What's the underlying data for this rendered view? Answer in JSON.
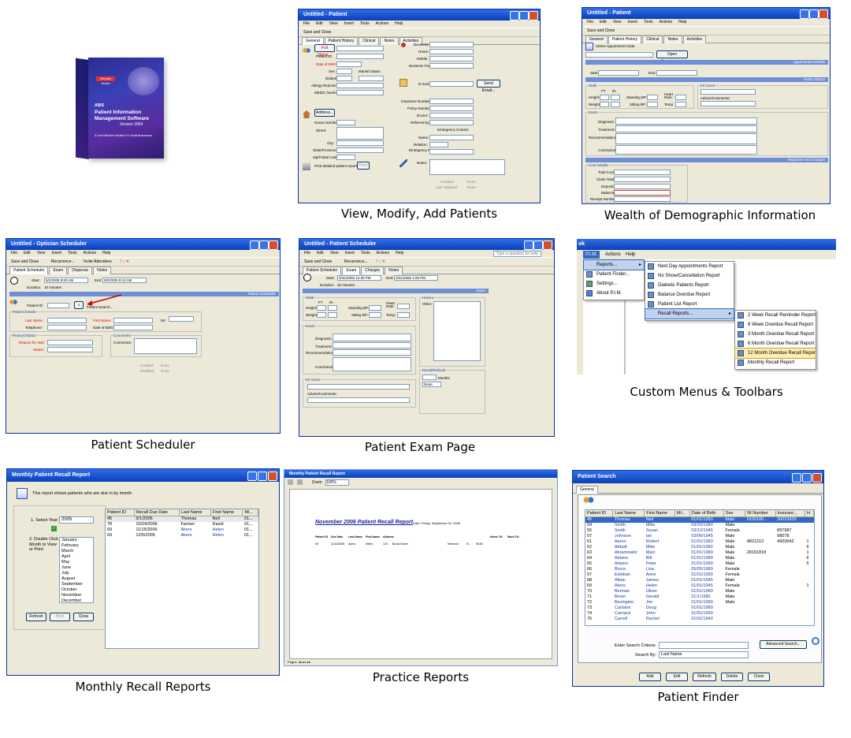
{
  "captions": {
    "view_modify": "View, Modify, Add Patients",
    "demographic": "Wealth of Demographic Information",
    "scheduler": "Patient Scheduler",
    "exam": "Patient Exam Page",
    "menus": "Custom Menus & Toolbars",
    "recall": "Monthly Recall Reports",
    "practice": "Practice Reports",
    "finder": "Patient Finder"
  },
  "box": {
    "brand": "ABIS",
    "title_line1": "Patient Information",
    "title_line2": "Management Software",
    "version": "Version 2004",
    "tagline": "A Cost Effective Solution For Small Businesses",
    "edition": "Standard Version"
  },
  "patient_win": {
    "title": "Untitled - Patient",
    "menu": [
      "File",
      "Edit",
      "View",
      "Insert",
      "Tools",
      "Actions",
      "Help"
    ],
    "toolbar_save": "Save and Close",
    "tabs": [
      "General",
      "Patient History",
      "Clinical",
      "Notes",
      "Activities"
    ],
    "labels": {
      "full_name": "Full Name...",
      "patient_id": "Patient ID:",
      "dob": "Date of Birth:",
      "sex": "Sex:",
      "marital": "Marital Status:",
      "diabetic": "Diabetic:",
      "allergy": "Allergy Reactions:",
      "medic": "MEDIC Number:",
      "address_btn": "Address...",
      "house": "House Number:",
      "street": "Street:",
      "city": "City:",
      "state": "State/Province:",
      "zip": "Zip/Postal Code:",
      "business": "Business:",
      "home": "Home:",
      "mobile": "Mobile:",
      "bizfax": "Business Fax:",
      "email": "E-mail:",
      "send_email": "Send Email...",
      "ins_number": "Insurance Number:",
      "policy": "Policy Number:",
      "doctor": "Doctor:",
      "referred": "Referred by:",
      "emergency": "Emergency Contact",
      "name": "Name:",
      "relation": "Relation:",
      "emergency_phone": "Emergency Phone:",
      "notes": "Notes:",
      "print": "Print detailed patient report...",
      "print_btn": "Print",
      "created": "Created:",
      "created_val": "None",
      "last_updated": "Last Updated:",
      "last_updated_val": "None"
    }
  },
  "history_win": {
    "title": "Untitled - Patient",
    "menu": [
      "File",
      "Edit",
      "View",
      "Insert",
      "Tools",
      "Actions",
      "Help"
    ],
    "toolbar_save": "Save and Close",
    "tabs": [
      "General",
      "Patient History",
      "Clinical",
      "Notes",
      "Activities"
    ],
    "select_date": "Select Appointment Date",
    "open_appt": "Open Appointment",
    "appt_details": "Appointment Details",
    "start": "Start:",
    "end": "End:",
    "exam_history": "Exam History",
    "walk": "Walk",
    "ft": "FT",
    "in": "IN",
    "height": "Height:",
    "weight": "Weight:",
    "standing_bp": "Standing BP:",
    "sitting_bp": "Sitting BP:",
    "heart_rate": "Heart Rate:",
    "temp": "Temp:",
    "kit_given": "Kit Given",
    "advice": "Advice/Comments:",
    "exam": "Exam",
    "diagnosis": "Diagnosis:",
    "treatment": "Treatment:",
    "recommendation": "Recommendation:",
    "conclusion": "Conclusion:",
    "payments": "Payments And Charges",
    "cost_details": "Cost Details",
    "total_cost": "Total Cost:",
    "claim_total": "Claim Total:",
    "deposit": "Deposit:",
    "balance": "Balance:",
    "receipt": "Receipt Number:"
  },
  "scheduler_win": {
    "title": "Untitled - Optician Scheduler",
    "menu": [
      "File",
      "Edit",
      "View",
      "Insert",
      "Tools",
      "Actions",
      "Help"
    ],
    "toolbar_save": "Save and Close",
    "toolbar_recurrence": "Recurrence...",
    "toolbar_invite": "Invite Attendees",
    "tabs": [
      "Patient Scheduler",
      "Exam",
      "Dispense",
      "Notes"
    ],
    "start": "Start:",
    "start_val": "9/2/2005 9:00 AM",
    "end": "End:",
    "end_val": "9/2/2005 9:10 AM",
    "duration": "Duration:",
    "duration_val": "10 minutes",
    "bar": "Patient Scheduler",
    "patient_id": "Patient ID:",
    "patient_search": "Patient Search...",
    "patient_details": "Patient Details",
    "last_name": "Last Name:",
    "first_name": "First Name:",
    "mi": "MI:",
    "telephone": "Telephone:",
    "dob": "Date of Birth:",
    "reason_status": "Reason/Status",
    "reason": "Reason for Visit:",
    "status": "Status:",
    "comments_grp": "Comments",
    "comments": "Comments:",
    "created": "Created:",
    "created_val": "None",
    "modified": "Modified:",
    "modified_val": "None"
  },
  "exam_win": {
    "title": "Untitled - Patient Scheduler",
    "menu": [
      "File",
      "Edit",
      "View",
      "Insert",
      "Tools",
      "Actions",
      "Help"
    ],
    "toolbar_save": "Save and Close",
    "toolbar_recurrence": "Recurrence...",
    "help_search": "Type a question for help",
    "tabs": [
      "Patient Scheduler",
      "Exam",
      "Charges",
      "Notes"
    ],
    "start": "Start:",
    "start_val": "3/31/2006 12:30 PM",
    "end": "End:",
    "end_val": "3/31/2006 1:00 PM",
    "duration": "Duration:",
    "duration_val": "30 minutes",
    "bar": "Exam",
    "walk": "Walk",
    "ft": "FT",
    "in": "IN",
    "height": "Height:",
    "weight": "Weight:",
    "standing_bp": "Standing BP:",
    "sitting_bp": "Sitting BP:",
    "heart_rate": "Heart Rate:",
    "temp": "Temp:",
    "history": "History",
    "other": "Other:",
    "exam": "Exam",
    "diagnosis": "Diagnosis:",
    "treatment": "Treatment:",
    "recommendation": "Recommendation:",
    "conclusion": "Conclusion:",
    "recall_rebook": "Recall/Rebook",
    "months": "Months",
    "none": "None",
    "kit_given": "Kit Given",
    "advice": "Advice/Comments:"
  },
  "menus_panel": {
    "title_fragment": "ok",
    "menubar": [
      "P.I.M.",
      "Actions",
      "Help"
    ],
    "pim_items": [
      "Reports...",
      "Patient Finder...",
      "Settings...",
      "About P.I.M."
    ],
    "reports_items": [
      "Next Day Appointments Report",
      "No Show/Cancellation Report",
      "Diabetic Patients Report",
      "Balance Overdue Report",
      "Patient List Report",
      "Recall Reports..."
    ],
    "recall_items": [
      "2 Week Recall Reminder Report",
      "6 Week Overdue Recall Report",
      "3 Month Overdue Recall Report",
      "6 Month Overdue Recall Report",
      "12 Month Overdue Recall Report",
      "Monthly Recall Report"
    ]
  },
  "recall_win": {
    "title": "Monthly Patient Recall Report",
    "info": "This report shows patients who are due in by month",
    "select_year": "1. Select Year:",
    "year": "2005",
    "double_click": "2. Double Click Month to View or Print",
    "months": [
      "January",
      "February",
      "March",
      "April",
      "May",
      "June",
      "July",
      "August",
      "September",
      "October",
      "November",
      "December"
    ],
    "buttons": [
      "Refresh",
      "Print",
      "Close"
    ],
    "columns": [
      "Patient ID",
      "Recall Due Date",
      "Last Name",
      "First Name",
      "Mi..."
    ],
    "rows": [
      [
        "45",
        "9/1/2006",
        "Thomas",
        "Neil",
        "01..."
      ],
      [
        "78",
        "10/24/2006",
        "Farmer",
        "David",
        "01..."
      ],
      [
        "69",
        "11/15/2006",
        "Akers",
        "Helen",
        "01..."
      ],
      [
        "69",
        "12/5/2006",
        "Akers",
        "Helen",
        "01..."
      ]
    ]
  },
  "practice_win": {
    "title": "Monthly Patient Recall Report",
    "zoom_label": "Zoom",
    "zoom": "100%",
    "heading": "November 2006 Patient Recall Report",
    "date": "Date: Friday, September 02, 2005",
    "columns": [
      "Patient ID",
      "Due Date",
      "Last Name",
      "First Name",
      "Address",
      "Home Tel.",
      "Work Tel."
    ],
    "row": [
      "69",
      "11/15/2006",
      "Akers",
      "Helen",
      "123",
      "Broad Street",
      "Hitchend",
      "FL",
      "98.60"
    ],
    "pages_label": "Pages:"
  },
  "finder_win": {
    "title": "Patient Search",
    "tab": "General",
    "columns": [
      "Patient ID",
      "Last Name",
      "First Name",
      "Mi...",
      "Date of Birth",
      "Sex",
      "NI Number",
      "Insuranc...",
      "H"
    ],
    "rows": [
      [
        "45",
        "Thomas",
        "Neil",
        "",
        "01/01/1950",
        "Male",
        "0100180...",
        "30023920",
        ""
      ],
      [
        "54",
        "Smith",
        "Mike",
        "",
        "03/20/1980",
        "Male",
        "",
        "",
        ""
      ],
      [
        "55",
        "Smith",
        "Susan",
        "",
        "03/12/1945",
        "Female",
        "",
        "897987",
        ""
      ],
      [
        "57",
        "Johnson",
        "Ian",
        "",
        "03/06/1945",
        "Male",
        "",
        "98078",
        ""
      ],
      [
        "61",
        "Aaron",
        "Robert",
        "",
        "01/01/1983",
        "Male",
        "4821212",
        "4920942",
        "1"
      ],
      [
        "62",
        "Abbott",
        "Mike",
        "",
        "01/01/1982",
        "Male",
        "",
        "",
        "6"
      ],
      [
        "63",
        "Abramowitz",
        "Marc",
        "",
        "01/01/1989",
        "Male",
        "28181818",
        "",
        "1"
      ],
      [
        "64",
        "Adams",
        "Bill",
        "",
        "01/01/1989",
        "Male",
        "",
        "",
        "6"
      ],
      [
        "65",
        "Adams",
        "Peter",
        "",
        "01/01/1990",
        "Male",
        "",
        "",
        "5"
      ],
      [
        "66",
        "Bruce",
        "Lisa",
        "",
        "05/05/1980",
        "Female",
        "",
        "",
        ""
      ],
      [
        "67",
        "Esteban",
        "Anne",
        "",
        "01/01/1990",
        "Female",
        "",
        "",
        ""
      ],
      [
        "68",
        "Alban",
        "James",
        "",
        "01/01/1945",
        "Male",
        "",
        "",
        ""
      ],
      [
        "69",
        "Akers",
        "Helen",
        "",
        "01/01/1945",
        "Female",
        "",
        "",
        "1"
      ],
      [
        "70",
        "Berman",
        "Oliver",
        "",
        "01/01/1980",
        "Male",
        "",
        "",
        ""
      ],
      [
        "71",
        "Bever",
        "Gerald",
        "",
        "01/1/1980",
        "Male",
        "",
        "",
        ""
      ],
      [
        "72",
        "Bevington",
        "Jim",
        "",
        "01/01/1990",
        "Male",
        "",
        "",
        ""
      ],
      [
        "73",
        "Carlston",
        "Doug",
        "",
        "01/01/1980",
        "",
        "",
        "",
        ""
      ],
      [
        "74",
        "Carnack",
        "John",
        "",
        "01/01/1990",
        "",
        "",
        "",
        ""
      ],
      [
        "75",
        "Carrell",
        "Rachel",
        "",
        "01/01/1940",
        "",
        "",
        "",
        ""
      ]
    ],
    "criteria_label": "Enter Search Criteria:",
    "search_by_label": "Search By:",
    "search_by": "Last Name",
    "advanced": "Advanced Search...",
    "buttons": [
      "Add",
      "Edit",
      "Refresh",
      "Delete",
      "Close"
    ]
  }
}
